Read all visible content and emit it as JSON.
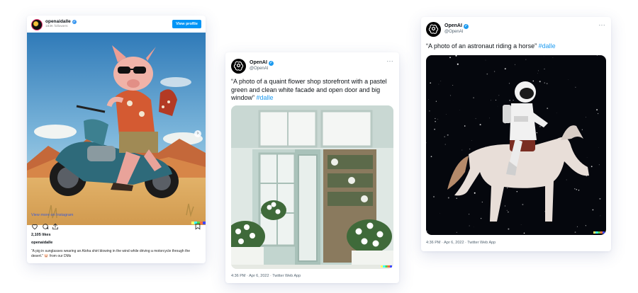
{
  "instagram": {
    "username": "openaidalle",
    "followers": "183K followers",
    "view_profile_label": "View profile",
    "view_more_label": "View more on Instagram",
    "likes": "2,105 likes",
    "caption_user": "openaidalle",
    "caption": "“A pig in sunglasses wearing an Aloha shirt blowing in the wind while driving a motorcycle through the desert.” 🐷 from our DMs",
    "icons": [
      "heart-icon",
      "comment-icon",
      "share-icon",
      "bookmark-icon"
    ]
  },
  "tweet1": {
    "name": "OpenAI",
    "handle": "@OpenAI",
    "text": "“A photo of a quaint flower shop storefront with a pastel green and clean white facade and open door and big window”",
    "hashtag": "#dalle",
    "timestamp": "4:36 PM · Apr 6, 2022 · Twitter Web App"
  },
  "tweet2": {
    "name": "OpenAI",
    "handle": "@OpenAI",
    "text": "“A photo of an astronaut riding a horse”",
    "hashtag": "#dalle",
    "timestamp": "4:36 PM · Apr 6, 2022 · Twitter Web App"
  },
  "colors": {
    "instagram_blue": "#0095f6",
    "twitter_blue": "#1d9bf0",
    "link_blue": "#3b5bd6"
  }
}
